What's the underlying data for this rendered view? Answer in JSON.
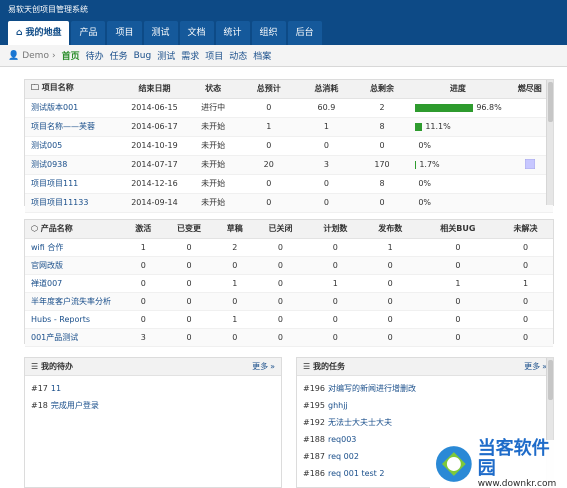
{
  "app": {
    "title": "易软天创项目管理系统"
  },
  "mainnav": [
    {
      "label": "我的地盘",
      "active": true
    },
    {
      "label": "产品"
    },
    {
      "label": "项目"
    },
    {
      "label": "测试"
    },
    {
      "label": "文档"
    },
    {
      "label": "统计"
    },
    {
      "label": "组织"
    },
    {
      "label": "后台"
    }
  ],
  "subnav": {
    "user": "Demo",
    "items": [
      {
        "label": "首页",
        "active": true
      },
      {
        "label": "待办"
      },
      {
        "label": "任务"
      },
      {
        "label": "Bug"
      },
      {
        "label": "测试"
      },
      {
        "label": "需求"
      },
      {
        "label": "项目"
      },
      {
        "label": "动态"
      },
      {
        "label": "档案"
      }
    ]
  },
  "projects": {
    "headers": [
      "项目名称",
      "结束日期",
      "状态",
      "总预计",
      "总消耗",
      "总剩余",
      "进度",
      "燃尽图"
    ],
    "rows": [
      {
        "name": "测试版本001",
        "end": "2014-06-15",
        "status": "进行中",
        "est": "0",
        "consumed": "60.9",
        "left": "2",
        "progress": 96.8,
        "progress_text": "96.8%",
        "burn": false
      },
      {
        "name": "项目名称——芙蓉",
        "end": "2014-06-17",
        "status": "未开始",
        "est": "1",
        "consumed": "1",
        "left": "8",
        "progress": 11.1,
        "progress_text": "11.1%",
        "burn": false
      },
      {
        "name": "测试005",
        "end": "2014-10-19",
        "status": "未开始",
        "est": "0",
        "consumed": "0",
        "left": "0",
        "progress": 0,
        "progress_text": "0%",
        "burn": false
      },
      {
        "name": "测试0938",
        "end": "2014-07-17",
        "status": "未开始",
        "est": "20",
        "consumed": "3",
        "left": "170",
        "progress": 1.7,
        "progress_text": "1.7%",
        "burn": true
      },
      {
        "name": "项目项目111",
        "end": "2014-12-16",
        "status": "未开始",
        "est": "0",
        "consumed": "0",
        "left": "8",
        "progress": 0,
        "progress_text": "0%",
        "burn": false
      },
      {
        "name": "项目项目11133",
        "end": "2014-09-14",
        "status": "未开始",
        "est": "0",
        "consumed": "0",
        "left": "0",
        "progress": 0,
        "progress_text": "0%",
        "burn": false
      }
    ]
  },
  "products": {
    "headers": [
      "产品名称",
      "激活",
      "已变更",
      "草稿",
      "已关闭",
      "计划数",
      "发布数",
      "相关BUG",
      "未解决"
    ],
    "rows": [
      {
        "name": "wifi 合作",
        "vals": [
          "1",
          "0",
          "2",
          "0",
          "0",
          "1",
          "0",
          "0"
        ]
      },
      {
        "name": "官网改版",
        "vals": [
          "0",
          "0",
          "0",
          "0",
          "0",
          "0",
          "0",
          "0"
        ]
      },
      {
        "name": "禅道007",
        "vals": [
          "0",
          "0",
          "1",
          "0",
          "1",
          "0",
          "1",
          "1"
        ]
      },
      {
        "name": "半年度客户流失率分析",
        "vals": [
          "0",
          "0",
          "0",
          "0",
          "0",
          "0",
          "0",
          "0"
        ]
      },
      {
        "name": "Hubs - Reports",
        "vals": [
          "0",
          "0",
          "1",
          "0",
          "0",
          "0",
          "0",
          "0"
        ]
      },
      {
        "name": "001产品测试",
        "vals": [
          "3",
          "0",
          "0",
          "0",
          "0",
          "0",
          "0",
          "0"
        ]
      }
    ]
  },
  "todo": {
    "title": "我的待办",
    "more": "更多",
    "items": [
      {
        "id": "#17",
        "text": "11"
      },
      {
        "id": "#18",
        "text": "完成用户登录"
      }
    ]
  },
  "tasks": {
    "title": "我的任务",
    "more": "更多",
    "items": [
      {
        "id": "#196",
        "text": "对编写的新闻进行增删改"
      },
      {
        "id": "#195",
        "text": "ghhjj"
      },
      {
        "id": "#192",
        "text": "无法士大夫士大夫"
      },
      {
        "id": "#188",
        "text": "req003"
      },
      {
        "id": "#187",
        "text": "req 002"
      },
      {
        "id": "#186",
        "text": "req 001 test 2"
      }
    ]
  },
  "watermark": {
    "title": "当客软件园",
    "sub": "www.downkr.com"
  },
  "colors": {
    "header": "#0d4a86",
    "progress": "#2e9b2e",
    "link": "#1a4f8b",
    "active": "#2b8d2b"
  }
}
